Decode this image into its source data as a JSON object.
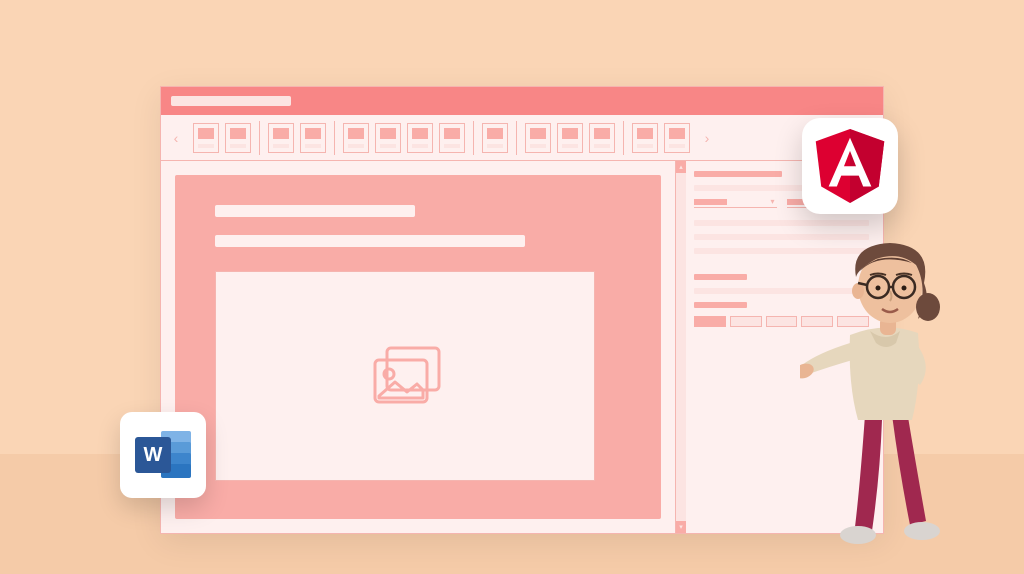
{
  "description": "Illustrative promo graphic of a pink word-processor-style application window with a 3D cartoon character presenting it, a Microsoft Word badge at lower-left, and an Angular framework badge at upper-right.",
  "badges": {
    "word_letter": "W",
    "angular_letter": "A"
  },
  "colors": {
    "bg": "#fad5b5",
    "window_border": "#f5b5b0",
    "titlebar": "#f88686",
    "panel_bg": "#fef0ef",
    "accent": "#f9aca7",
    "soft_fill": "#fce4e2",
    "word_blue": "#2b5797",
    "angular_red": "#dd0031"
  },
  "ribbon": {
    "groups": [
      2,
      2,
      4,
      1,
      3,
      2
    ]
  },
  "document": {
    "lines": 2,
    "has_image_placeholder": true
  },
  "side_panel": {
    "dropdown_fills": [
      0.4,
      0.5
    ],
    "display_boxes": 5
  }
}
